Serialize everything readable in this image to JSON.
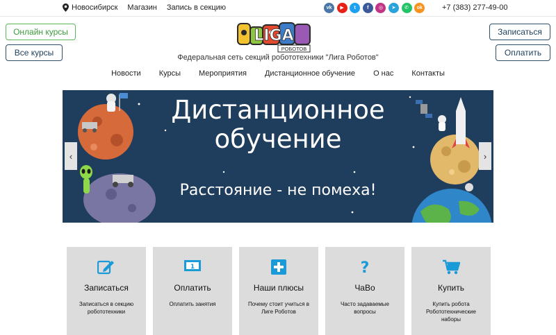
{
  "topbar": {
    "city": "Новосибирск",
    "links": [
      "Магазин",
      "Запись в секцию"
    ],
    "socials": [
      {
        "name": "vk-icon",
        "glyph": "vk",
        "color": "#4a76a8"
      },
      {
        "name": "youtube-icon",
        "glyph": "▶",
        "color": "#e62117"
      },
      {
        "name": "twitter-icon",
        "glyph": "t",
        "color": "#1da1f2"
      },
      {
        "name": "facebook-icon",
        "glyph": "f",
        "color": "#3b5998"
      },
      {
        "name": "instagram-icon",
        "glyph": "◎",
        "color": "#c13584"
      },
      {
        "name": "telegram-icon",
        "glyph": "➤",
        "color": "#2aa3db"
      },
      {
        "name": "whatsapp-icon",
        "glyph": "✆",
        "color": "#25c367"
      },
      {
        "name": "odnoklassniki-icon",
        "glyph": "ok",
        "color": "#f7931e"
      }
    ],
    "phone": "+7 (383) 277-49-00"
  },
  "header": {
    "online_courses": "Онлайн курсы",
    "all_courses": "Все курсы",
    "signup": "Записаться",
    "pay": "Оплатить",
    "logo_text": "LIGA",
    "logo_sub": "РОБОТОВ",
    "tagline": "Федеральная сеть секций робототехники \"Лига Роботов\""
  },
  "nav": [
    "Новости",
    "Курсы",
    "Мероприятия",
    "Дистанционное обучение",
    "О нас",
    "Контакты"
  ],
  "banner": {
    "title_line1": "Дистанционное",
    "title_line2": "обучение",
    "subtitle": "Расстояние - не помеха!",
    "prev": "‹",
    "next": "›"
  },
  "cards": [
    {
      "icon": "edit-icon",
      "title": "Записаться",
      "desc": "Записаться в секцию робототехники"
    },
    {
      "icon": "banknote-icon",
      "title": "Оплатить",
      "desc": "Оплатить занятия"
    },
    {
      "icon": "plus-icon",
      "title": "Наши плюсы",
      "desc": "Почему стоит учиться в Лиге Роботов"
    },
    {
      "icon": "question-icon",
      "title": "ЧаВо",
      "desc": "Часто задаваемые вопросы"
    },
    {
      "icon": "cart-icon",
      "title": "Купить",
      "desc": "Купить робота Робототехнические наборы"
    }
  ],
  "colors": {
    "accent_blue": "#1a9ad6",
    "banner_bg": "#1f3d5c",
    "green": "#5cb85c",
    "navy": "#2c4f6e"
  }
}
